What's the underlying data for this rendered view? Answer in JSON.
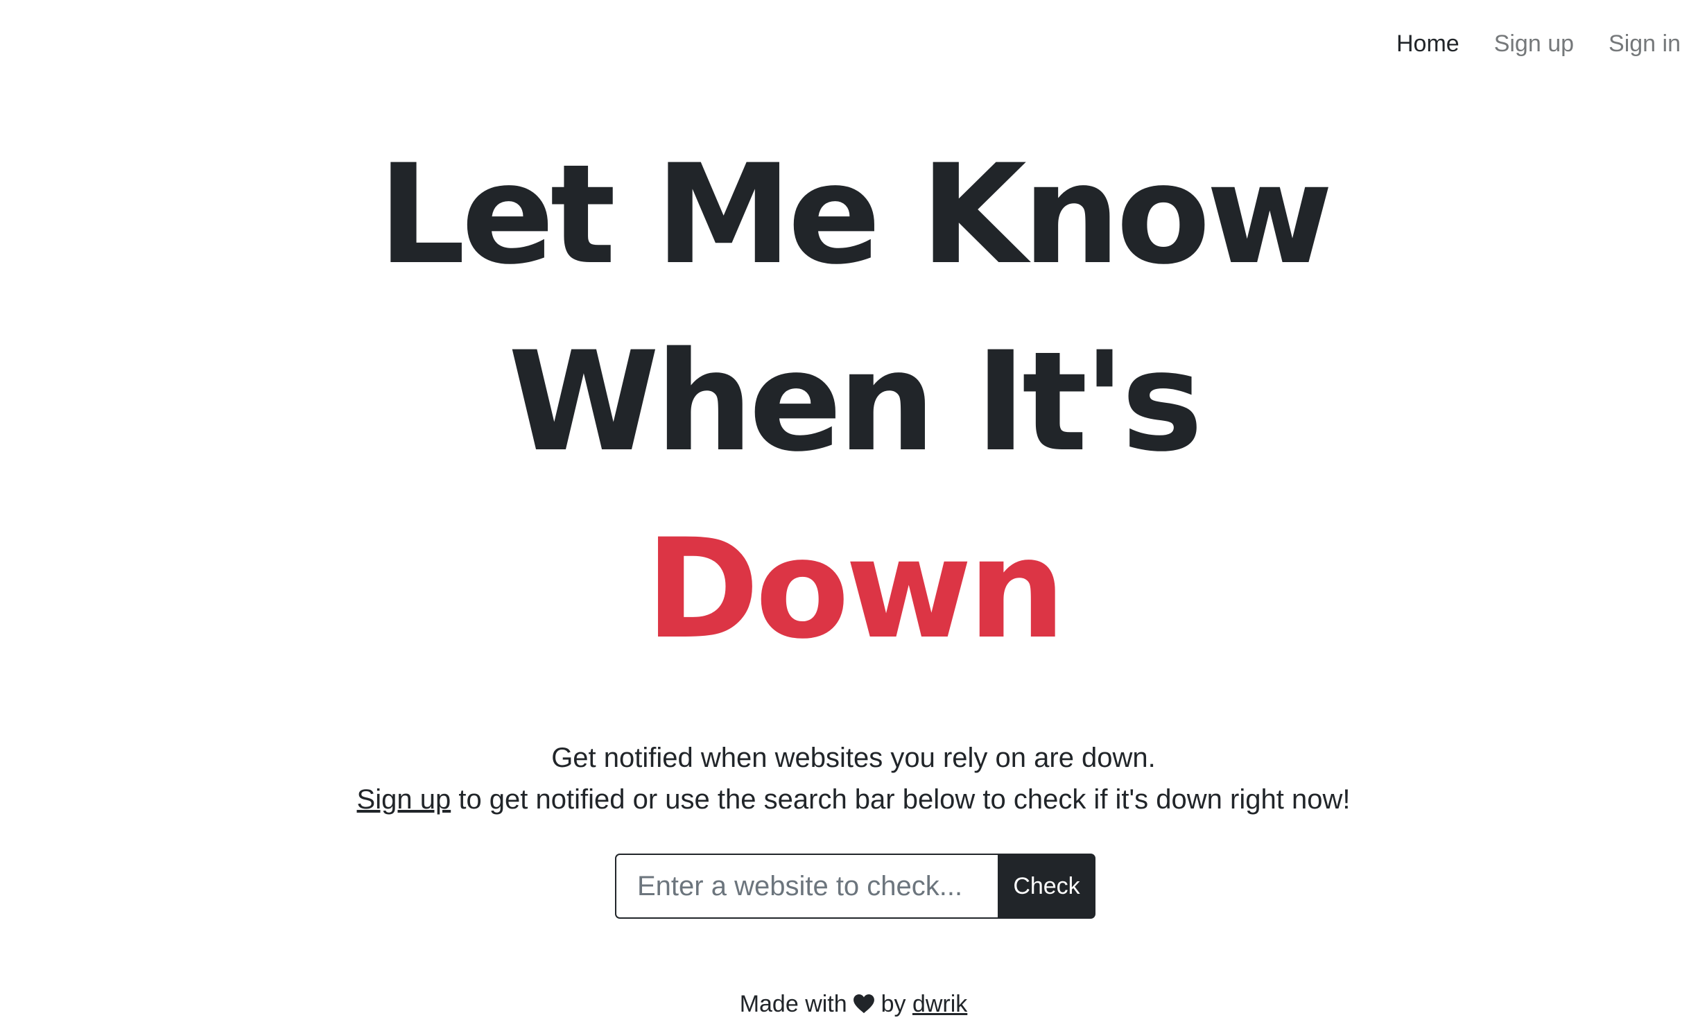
{
  "nav": {
    "items": [
      {
        "label": "Home",
        "active": true
      },
      {
        "label": "Sign up",
        "active": false
      },
      {
        "label": "Sign in",
        "active": false
      }
    ]
  },
  "hero": {
    "line1": "Let Me Know",
    "line2": "When It's",
    "accent_word": "Down",
    "accent_color": "#dc3545"
  },
  "lead": {
    "line1": "Get notified when websites you rely on are down.",
    "signup_link": "Sign up",
    "line2_rest": " to get notified or use the search bar below to check if it's down right now!"
  },
  "search": {
    "placeholder": "Enter a website to check...",
    "value": "",
    "button_label": "Check"
  },
  "footer": {
    "prefix": "Made with",
    "icon": "heart-icon",
    "by": " by ",
    "author": "dwrik"
  }
}
